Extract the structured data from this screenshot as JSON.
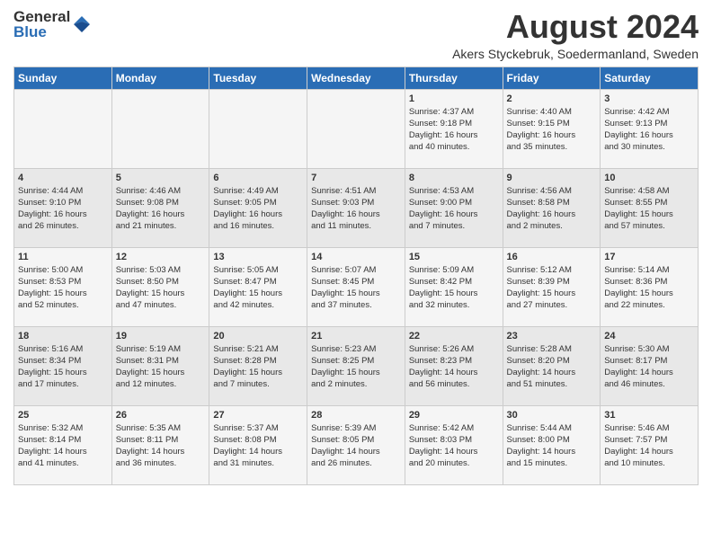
{
  "header": {
    "logo_general": "General",
    "logo_blue": "Blue",
    "month_year": "August 2024",
    "location": "Akers Styckebruk, Soedermanland, Sweden"
  },
  "days_of_week": [
    "Sunday",
    "Monday",
    "Tuesday",
    "Wednesday",
    "Thursday",
    "Friday",
    "Saturday"
  ],
  "weeks": [
    [
      {
        "day": "",
        "info": ""
      },
      {
        "day": "",
        "info": ""
      },
      {
        "day": "",
        "info": ""
      },
      {
        "day": "",
        "info": ""
      },
      {
        "day": "1",
        "info": "Sunrise: 4:37 AM\nSunset: 9:18 PM\nDaylight: 16 hours\nand 40 minutes."
      },
      {
        "day": "2",
        "info": "Sunrise: 4:40 AM\nSunset: 9:15 PM\nDaylight: 16 hours\nand 35 minutes."
      },
      {
        "day": "3",
        "info": "Sunrise: 4:42 AM\nSunset: 9:13 PM\nDaylight: 16 hours\nand 30 minutes."
      }
    ],
    [
      {
        "day": "4",
        "info": "Sunrise: 4:44 AM\nSunset: 9:10 PM\nDaylight: 16 hours\nand 26 minutes."
      },
      {
        "day": "5",
        "info": "Sunrise: 4:46 AM\nSunset: 9:08 PM\nDaylight: 16 hours\nand 21 minutes."
      },
      {
        "day": "6",
        "info": "Sunrise: 4:49 AM\nSunset: 9:05 PM\nDaylight: 16 hours\nand 16 minutes."
      },
      {
        "day": "7",
        "info": "Sunrise: 4:51 AM\nSunset: 9:03 PM\nDaylight: 16 hours\nand 11 minutes."
      },
      {
        "day": "8",
        "info": "Sunrise: 4:53 AM\nSunset: 9:00 PM\nDaylight: 16 hours\nand 7 minutes."
      },
      {
        "day": "9",
        "info": "Sunrise: 4:56 AM\nSunset: 8:58 PM\nDaylight: 16 hours\nand 2 minutes."
      },
      {
        "day": "10",
        "info": "Sunrise: 4:58 AM\nSunset: 8:55 PM\nDaylight: 15 hours\nand 57 minutes."
      }
    ],
    [
      {
        "day": "11",
        "info": "Sunrise: 5:00 AM\nSunset: 8:53 PM\nDaylight: 15 hours\nand 52 minutes."
      },
      {
        "day": "12",
        "info": "Sunrise: 5:03 AM\nSunset: 8:50 PM\nDaylight: 15 hours\nand 47 minutes."
      },
      {
        "day": "13",
        "info": "Sunrise: 5:05 AM\nSunset: 8:47 PM\nDaylight: 15 hours\nand 42 minutes."
      },
      {
        "day": "14",
        "info": "Sunrise: 5:07 AM\nSunset: 8:45 PM\nDaylight: 15 hours\nand 37 minutes."
      },
      {
        "day": "15",
        "info": "Sunrise: 5:09 AM\nSunset: 8:42 PM\nDaylight: 15 hours\nand 32 minutes."
      },
      {
        "day": "16",
        "info": "Sunrise: 5:12 AM\nSunset: 8:39 PM\nDaylight: 15 hours\nand 27 minutes."
      },
      {
        "day": "17",
        "info": "Sunrise: 5:14 AM\nSunset: 8:36 PM\nDaylight: 15 hours\nand 22 minutes."
      }
    ],
    [
      {
        "day": "18",
        "info": "Sunrise: 5:16 AM\nSunset: 8:34 PM\nDaylight: 15 hours\nand 17 minutes."
      },
      {
        "day": "19",
        "info": "Sunrise: 5:19 AM\nSunset: 8:31 PM\nDaylight: 15 hours\nand 12 minutes."
      },
      {
        "day": "20",
        "info": "Sunrise: 5:21 AM\nSunset: 8:28 PM\nDaylight: 15 hours\nand 7 minutes."
      },
      {
        "day": "21",
        "info": "Sunrise: 5:23 AM\nSunset: 8:25 PM\nDaylight: 15 hours\nand 2 minutes."
      },
      {
        "day": "22",
        "info": "Sunrise: 5:26 AM\nSunset: 8:23 PM\nDaylight: 14 hours\nand 56 minutes."
      },
      {
        "day": "23",
        "info": "Sunrise: 5:28 AM\nSunset: 8:20 PM\nDaylight: 14 hours\nand 51 minutes."
      },
      {
        "day": "24",
        "info": "Sunrise: 5:30 AM\nSunset: 8:17 PM\nDaylight: 14 hours\nand 46 minutes."
      }
    ],
    [
      {
        "day": "25",
        "info": "Sunrise: 5:32 AM\nSunset: 8:14 PM\nDaylight: 14 hours\nand 41 minutes."
      },
      {
        "day": "26",
        "info": "Sunrise: 5:35 AM\nSunset: 8:11 PM\nDaylight: 14 hours\nand 36 minutes."
      },
      {
        "day": "27",
        "info": "Sunrise: 5:37 AM\nSunset: 8:08 PM\nDaylight: 14 hours\nand 31 minutes."
      },
      {
        "day": "28",
        "info": "Sunrise: 5:39 AM\nSunset: 8:05 PM\nDaylight: 14 hours\nand 26 minutes."
      },
      {
        "day": "29",
        "info": "Sunrise: 5:42 AM\nSunset: 8:03 PM\nDaylight: 14 hours\nand 20 minutes."
      },
      {
        "day": "30",
        "info": "Sunrise: 5:44 AM\nSunset: 8:00 PM\nDaylight: 14 hours\nand 15 minutes."
      },
      {
        "day": "31",
        "info": "Sunrise: 5:46 AM\nSunset: 7:57 PM\nDaylight: 14 hours\nand 10 minutes."
      }
    ]
  ]
}
